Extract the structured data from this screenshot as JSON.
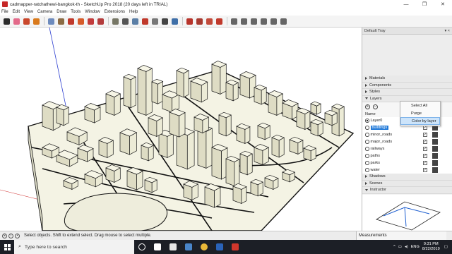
{
  "window": {
    "title": "cadmapper-ratchathewi-bangkok-th - SketchUp Pro 2018 (20 days left in TRIAL)",
    "minimize": "—",
    "maximize": "❐",
    "close": "✕"
  },
  "menu": [
    "File",
    "Edit",
    "View",
    "Camera",
    "Draw",
    "Tools",
    "Window",
    "Extensions",
    "Help"
  ],
  "toolbar": {
    "tools": [
      {
        "name": "select-tool",
        "color": "#2b2b2b"
      },
      {
        "name": "eraser-tool",
        "color": "#e36a8a"
      },
      {
        "name": "line-tool",
        "color": "#c9472b"
      },
      {
        "name": "arc-tool",
        "color": "#d97a1c"
      },
      {
        "name": "shape-tool",
        "color": "#6d8bbd"
      },
      {
        "name": "pushpull-tool",
        "color": "#8b6b43"
      },
      {
        "name": "move-tool",
        "color": "#c0392b"
      },
      {
        "name": "rotate-tool",
        "color": "#d65b2a"
      },
      {
        "name": "scale-tool",
        "color": "#c23b3b"
      },
      {
        "name": "offset-tool",
        "color": "#b33c3c"
      },
      {
        "name": "tape-measure-tool",
        "color": "#777766"
      },
      {
        "name": "text-tool",
        "color": "#555"
      },
      {
        "name": "paint-bucket-tool",
        "color": "#5b7fa6"
      },
      {
        "name": "orbit-tool",
        "color": "#c0392b"
      },
      {
        "name": "pan-tool",
        "color": "#777"
      },
      {
        "name": "zoom-tool",
        "color": "#444"
      },
      {
        "name": "zoom-extents-tool",
        "color": "#3f6fa8"
      },
      {
        "name": "warehouse-tool",
        "color": "#b8342b"
      },
      {
        "name": "extension-warehouse-tool",
        "color": "#a83a30"
      },
      {
        "name": "layout-tool",
        "color": "#c24a3a"
      },
      {
        "name": "extension-manager-tool",
        "color": "#c0392b"
      }
    ],
    "views": [
      {
        "name": "iso-view",
        "color": "#666"
      },
      {
        "name": "top-view",
        "color": "#666"
      },
      {
        "name": "front-view",
        "color": "#666"
      },
      {
        "name": "right-view",
        "color": "#666"
      },
      {
        "name": "back-view",
        "color": "#666"
      },
      {
        "name": "left-view",
        "color": "#666"
      }
    ]
  },
  "tray": {
    "title": "Default Tray",
    "panels": [
      "Materials",
      "Components",
      "Styles"
    ],
    "layers": {
      "title": "Layers",
      "column_name": "Name",
      "items": [
        {
          "name": "Layer0",
          "active": true,
          "visible": true
        },
        {
          "name": "buildings",
          "active": false,
          "visible": true,
          "selected": true
        },
        {
          "name": "minor_roads",
          "active": false,
          "visible": true
        },
        {
          "name": "major_roads",
          "active": false,
          "visible": true
        },
        {
          "name": "railways",
          "active": false,
          "visible": true
        },
        {
          "name": "paths",
          "active": false,
          "visible": true
        },
        {
          "name": "parks",
          "active": false,
          "visible": true
        },
        {
          "name": "water",
          "active": false,
          "visible": true
        }
      ]
    },
    "panels_after": [
      "Shadows",
      "Scenes"
    ],
    "instructor": "Instructor",
    "context_menu": [
      "Select All",
      "Purge",
      "Color by layer"
    ]
  },
  "status": {
    "text": "Select objects. Shift to extend select. Drag mouse to select multiple.",
    "measurements_label": "Measurements"
  },
  "taskbar": {
    "search_placeholder": "Type here to search",
    "apps": [
      {
        "name": "cortana-icon",
        "color": "#ffffff"
      },
      {
        "name": "task-view-icon",
        "color": "#ffffff"
      },
      {
        "name": "unreal-icon",
        "color": "#e6e6e6"
      },
      {
        "name": "sketchup-icon",
        "color": "#4a86c9"
      },
      {
        "name": "chrome-icon",
        "color": "#e8b838"
      },
      {
        "name": "revit-icon",
        "color": "#2a63b8"
      },
      {
        "name": "sketchup-active-icon",
        "color": "#d0372c"
      }
    ],
    "lang": "ENG",
    "time": "9:31 PM",
    "date": "8/22/2019"
  },
  "colors": {
    "building_fill": "#ecebd6",
    "building_stroke": "#1d1d1d",
    "ground": "#f2f2e6",
    "selection": "#1e78d8"
  }
}
